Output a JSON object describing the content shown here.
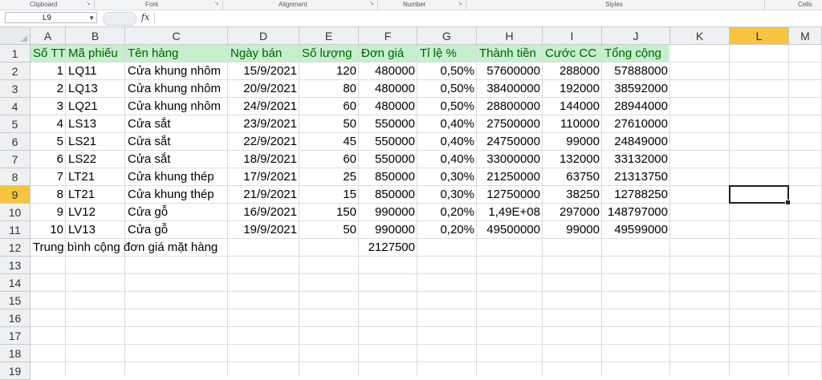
{
  "ribbon": {
    "groups": [
      "Clipboard",
      "Font",
      "Alignment",
      "Number",
      "Styles",
      "Cells"
    ]
  },
  "formula_bar": {
    "name_box": "L9",
    "fx_label": "fx",
    "formula": ""
  },
  "columns": [
    "A",
    "B",
    "C",
    "D",
    "E",
    "F",
    "G",
    "H",
    "I",
    "J",
    "K",
    "L",
    "M"
  ],
  "selected_column": "L",
  "rows": [
    "1",
    "2",
    "3",
    "4",
    "5",
    "6",
    "7",
    "8",
    "9",
    "10",
    "11",
    "12",
    "13",
    "14",
    "15",
    "16",
    "17",
    "18",
    "19"
  ],
  "selected_row": "9",
  "header_fill_color": "#c6efce",
  "header_text_color": "#006100",
  "table": {
    "headers": [
      "Số TT",
      "Mã phiếu",
      "Tên hàng",
      "Ngày bán",
      "Số lượng",
      "Đơn giá",
      "Tỉ lệ %",
      "Thành tiền",
      "Cước CC",
      "Tổng cộng"
    ],
    "rows": [
      [
        "1",
        "LQ11",
        "Cửa khung nhôm",
        "15/9/2021",
        "120",
        "480000",
        "0,50%",
        "57600000",
        "288000",
        "57888000"
      ],
      [
        "2",
        "LQ13",
        "Cửa khung nhôm",
        "20/9/2021",
        "80",
        "480000",
        "0,50%",
        "38400000",
        "192000",
        "38592000"
      ],
      [
        "3",
        "LQ21",
        "Cửa khung nhôm",
        "24/9/2021",
        "60",
        "480000",
        "0,50%",
        "28800000",
        "144000",
        "28944000"
      ],
      [
        "4",
        "LS13",
        "Cửa sắt",
        "23/9/2021",
        "50",
        "550000",
        "0,40%",
        "27500000",
        "110000",
        "27610000"
      ],
      [
        "5",
        "LS21",
        "Cửa sắt",
        "22/9/2021",
        "45",
        "550000",
        "0,40%",
        "24750000",
        "99000",
        "24849000"
      ],
      [
        "6",
        "LS22",
        "Cửa sắt",
        "18/9/2021",
        "60",
        "550000",
        "0,40%",
        "33000000",
        "132000",
        "33132000"
      ],
      [
        "7",
        "LT21",
        "Cửa khung thép",
        "17/9/2021",
        "25",
        "850000",
        "0,30%",
        "21250000",
        "63750",
        "21313750"
      ],
      [
        "8",
        "LT21",
        "Cửa khung thép",
        "21/9/2021",
        "15",
        "850000",
        "0,30%",
        "12750000",
        "38250",
        "12788250"
      ],
      [
        "9",
        "LV12",
        "Cửa gỗ",
        "16/9/2021",
        "150",
        "990000",
        "0,20%",
        "1,49E+08",
        "297000",
        "148797000"
      ],
      [
        "10",
        "LV13",
        "Cửa gỗ",
        "19/9/2021",
        "50",
        "990000",
        "0,20%",
        "49500000",
        "99000",
        "49599000"
      ]
    ],
    "summary_label": "Trung bình cộng đơn giá mặt hàng",
    "summary_value": "2127500"
  }
}
